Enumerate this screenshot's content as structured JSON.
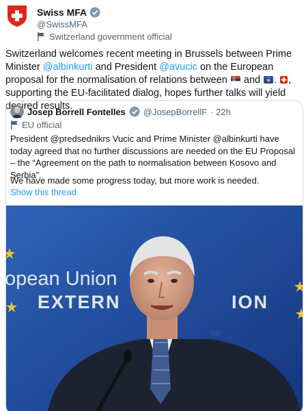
{
  "author": {
    "name": "Swiss MFA",
    "handle": "@SwissMFA",
    "label": "Switzerland government official",
    "verified_icon": "verified-badge-icon",
    "avatar_icon": "swiss-flag-shield"
  },
  "tweet": {
    "part1": "Switzerland welcomes recent meeting in Brussels between Prime Minister ",
    "mention1": "@albinkurti",
    "part2": " and President ",
    "mention2": "@avucic",
    "part3": " on the European proposal for the normalisation of relations between ",
    "part4": " and ",
    "part5": ". ",
    "part6": ", supporting the EU-facilitated dialog, hopes further talks will yield desired results."
  },
  "quote": {
    "name": "Josep Borrell Fontelles",
    "handle": "@JosepBorrellF",
    "time": "· 22h",
    "label": "EU official",
    "text1": "President @predsednikrs Vucic and Prime Minister @albinkurti have today agreed that no further discussions are needed on the EU Proposal – the “Agreement on the path to normalisation between Kosovo and Serbia”.",
    "text2": "We have made some progress today, but more work is needed.",
    "show_thread": "Show this thread",
    "photo_text_line1": "opean Union",
    "photo_text_line2": "EXTERN",
    "photo_text_line3": "ION"
  },
  "colors": {
    "link": "#1d9bf0",
    "secondary": "#536471",
    "swiss_red": "#e1251b",
    "eu_blue": "#1f4fa3"
  }
}
